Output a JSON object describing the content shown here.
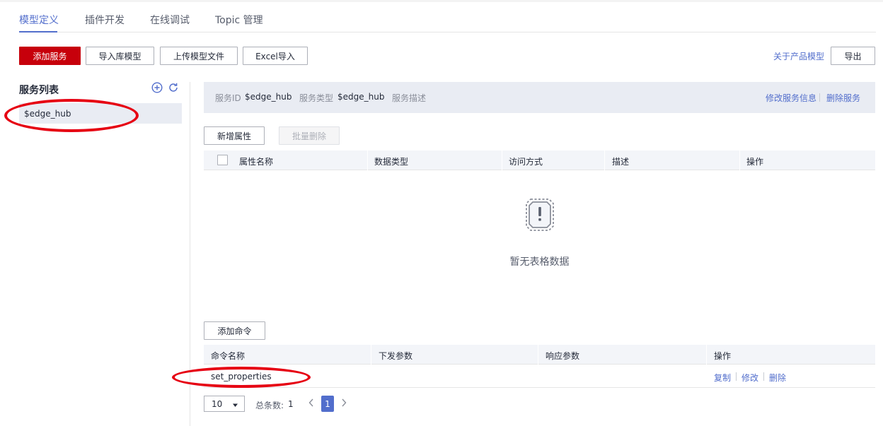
{
  "tabs": [
    {
      "label": "模型定义",
      "active": true
    },
    {
      "label": "插件开发"
    },
    {
      "label": "在线调试"
    },
    {
      "label": "Topic 管理"
    }
  ],
  "toolbar": {
    "add_service": "添加服务",
    "import_library_model": "导入库模型",
    "upload_model_file": "上传模型文件",
    "excel_import": "Excel导入",
    "about_product_model": "关于产品模型",
    "export": "导出"
  },
  "sidebar": {
    "title": "服务列表",
    "services": [
      {
        "name": "$edge_hub",
        "selected": true
      }
    ]
  },
  "service_info": {
    "id_label": "服务ID",
    "id_value": "$edge_hub",
    "type_label": "服务类型",
    "type_value": "$edge_hub",
    "desc_label": "服务描述",
    "edit_link": "修改服务信息",
    "delete_link": "删除服务"
  },
  "properties": {
    "add_button": "新增属性",
    "batch_delete_button": "批量删除",
    "columns": [
      "属性名称",
      "数据类型",
      "访问方式",
      "描述",
      "操作"
    ],
    "empty_text": "暂无表格数据"
  },
  "commands": {
    "add_button": "添加命令",
    "columns": [
      "命令名称",
      "下发参数",
      "响应参数",
      "操作"
    ],
    "rows": [
      {
        "name": "set_properties",
        "actions": [
          "复制",
          "修改",
          "删除"
        ]
      }
    ]
  },
  "pagination": {
    "page_size": "10",
    "total_label": "总条数:",
    "total_count": "1",
    "current_page": "1"
  },
  "colors": {
    "primary_red": "#c7000b",
    "link_blue": "#526ecc",
    "annotation_red": "#e60012"
  }
}
